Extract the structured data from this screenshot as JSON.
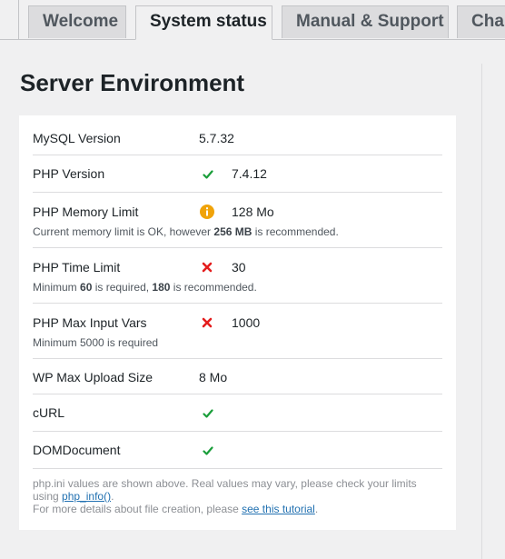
{
  "tabs": [
    {
      "label": "Welcome"
    },
    {
      "label": "System status"
    },
    {
      "label": "Manual & Support"
    },
    {
      "label": "Char"
    }
  ],
  "section_title": "Server Environment",
  "rows": {
    "mysql": {
      "label": "MySQL Version",
      "value": "5.7.32"
    },
    "php_version": {
      "label": "PHP Version",
      "value": "7.4.12",
      "status": "ok"
    },
    "php_memory": {
      "label": "PHP Memory Limit",
      "value": "128 Mo",
      "status": "warning",
      "note_pre": "Current memory limit is OK, however ",
      "note_bold": "256 MB",
      "note_post": " is recommended."
    },
    "php_time": {
      "label": "PHP Time Limit",
      "value": "30",
      "status": "error",
      "note_pre": "Minimum ",
      "note_bold1": "60",
      "note_mid": " is required, ",
      "note_bold2": "180",
      "note_post": " is recommended."
    },
    "php_input": {
      "label": "PHP Max Input Vars",
      "value": "1000",
      "status": "error",
      "note": "Minimum 5000 is required"
    },
    "wp_upload": {
      "label": "WP Max Upload Size",
      "value": "8 Mo"
    },
    "curl": {
      "label": "cURL",
      "status": "ok"
    },
    "domdocument": {
      "label": "DOMDocument",
      "status": "ok"
    }
  },
  "footer": {
    "line1": "php.ini values are shown above. Real values may vary, please check your limits",
    "line2_pre": "using ",
    "line2_link": "php_info()",
    "line2_post": ".",
    "line3_pre": "For more details about file creation, please ",
    "line3_link": "see this tutorial",
    "line3_post": "."
  },
  "colors": {
    "ok": "#1a9e3a",
    "warning": "#f0a30a",
    "error": "#e41d1d",
    "link": "#2271b1"
  },
  "icons": {
    "ok": "check-icon",
    "warning": "info-warning-icon",
    "error": "cross-icon"
  }
}
